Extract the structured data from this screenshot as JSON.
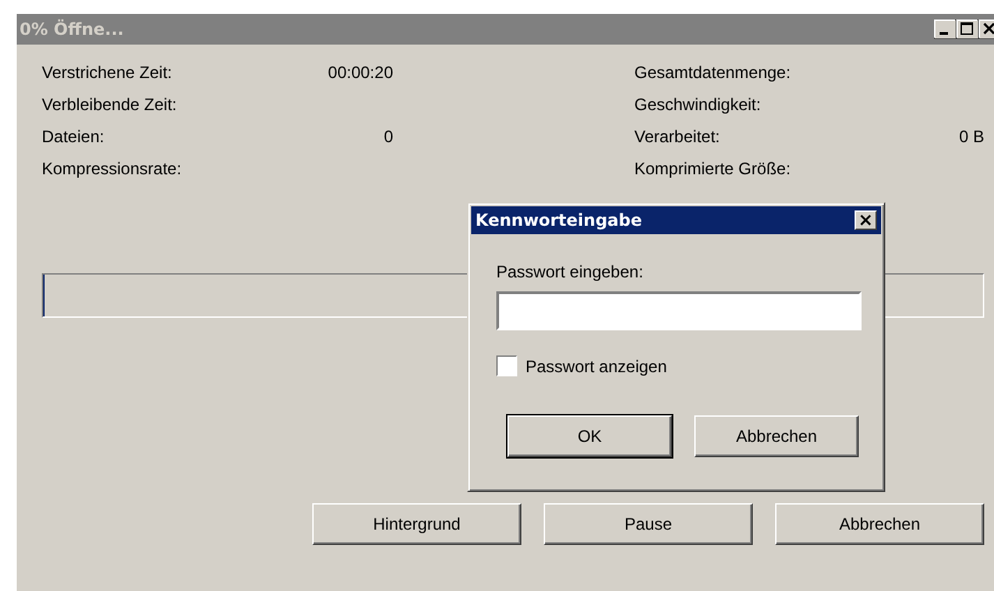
{
  "window": {
    "title": "0% Öffne..."
  },
  "stats_left": [
    {
      "label": "Verstrichene Zeit:",
      "value": "00:00:20"
    },
    {
      "label": "Verbleibende Zeit:"
    },
    {
      "label": "Dateien:",
      "value": "0"
    },
    {
      "label": "Kompressionsrate:"
    }
  ],
  "stats_right": [
    {
      "label": "Gesamtdatenmenge:"
    },
    {
      "label": "Geschwindigkeit:"
    },
    {
      "label": "Verarbeitet:",
      "value": "0 B"
    },
    {
      "label": "Komprimierte Größe:"
    }
  ],
  "progress": {
    "level": 0
  },
  "buttons": [
    {
      "label": "Hintergrund"
    },
    {
      "label": "Pause"
    },
    {
      "label": "Abbrechen"
    }
  ],
  "dialog": {
    "title": "Kennworteingabe",
    "close": "×",
    "field_label": "Passwort eingeben:",
    "checkbox": {
      "label": "Passwort anzeigen",
      "checked": false
    },
    "buttons": [
      {
        "label": "OK",
        "default": true
      },
      {
        "label": "Abbrechen",
        "default": false
      }
    ]
  }
}
